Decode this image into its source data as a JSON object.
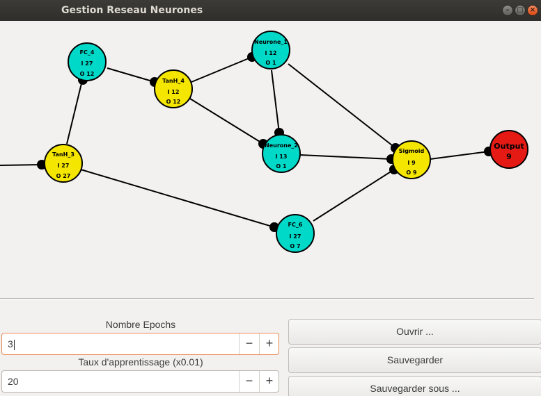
{
  "window": {
    "title": "Gestion Reseau Neurones"
  },
  "network": {
    "colors": {
      "fc": "#00d8c8",
      "activation": "#f5e600",
      "output": "#e51a14",
      "edge": "#000000"
    },
    "nodes": [
      {
        "id": "fc_4",
        "name": "FC_4",
        "in": "I 27",
        "out": "O 12"
      },
      {
        "id": "tanh_4",
        "name": "TanH_4",
        "in": "I 12",
        "out": "O 12"
      },
      {
        "id": "neurone_1",
        "name": "Neurone_1",
        "in": "I 12",
        "out": "O 1"
      },
      {
        "id": "neurone_2",
        "name": "Neurone_2",
        "in": "I 13",
        "out": "O 1"
      },
      {
        "id": "tanh_3",
        "name": "TanH_3",
        "in": "I 27",
        "out": "O 27"
      },
      {
        "id": "sigmoid",
        "name": "Sigmoid",
        "in": "I 9",
        "out": "O 9"
      },
      {
        "id": "fc_6",
        "name": "FC_6",
        "in": "I 27",
        "out": "O 7"
      },
      {
        "id": "output",
        "name": "Output",
        "value": "9"
      }
    ]
  },
  "controls": {
    "epochs": {
      "label": "Nombre Epochs",
      "value": "3",
      "minus": "−",
      "plus": "+"
    },
    "learning_rate": {
      "label": "Taux d'apprentissage (x0.01)",
      "value": "20",
      "minus": "−",
      "plus": "+"
    }
  },
  "buttons": {
    "open": "Ouvrir ...",
    "save": "Sauvegarder",
    "save_as": "Sauvegarder sous ..."
  }
}
